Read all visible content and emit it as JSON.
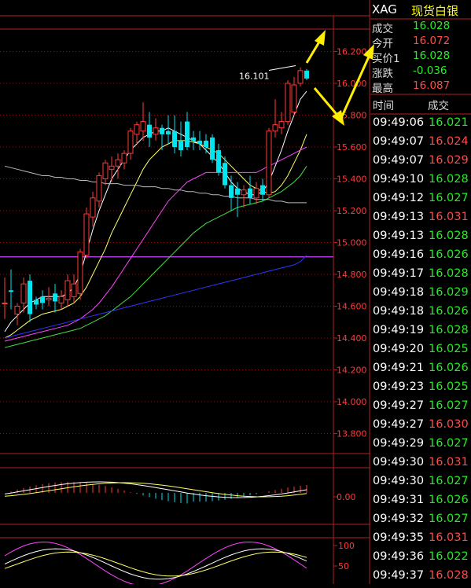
{
  "quote": {
    "symbol": "XAG",
    "name": "现货白银",
    "rows": [
      {
        "label": "成交",
        "value": "16.028",
        "color": "#22ee22"
      },
      {
        "label": "今开",
        "value": "16.072",
        "color": "#ff4a4a"
      },
      {
        "label": "买价1",
        "value": "16.028",
        "color": "#22ee22"
      },
      {
        "label": "涨跌",
        "value": "-0.036",
        "color": "#22ee22"
      },
      {
        "label": "最高",
        "value": "16.087",
        "color": "#ff4a4a"
      }
    ]
  },
  "ticks": {
    "col_time": "时间",
    "col_price": "成交",
    "rows": [
      {
        "time": "09:49:06",
        "price": "16.021"
      },
      {
        "time": "09:49:07",
        "price": "16.024"
      },
      {
        "time": "09:49:07",
        "price": "16.029"
      },
      {
        "time": "09:49:10",
        "price": "16.028"
      },
      {
        "time": "09:49:12",
        "price": "16.027"
      },
      {
        "time": "09:49:13",
        "price": "16.031"
      },
      {
        "time": "09:49:13",
        "price": "16.028"
      },
      {
        "time": "09:49:16",
        "price": "16.026"
      },
      {
        "time": "09:49:17",
        "price": "16.028"
      },
      {
        "time": "09:49:18",
        "price": "16.029"
      },
      {
        "time": "09:49:18",
        "price": "16.026"
      },
      {
        "time": "09:49:19",
        "price": "16.028"
      },
      {
        "time": "09:49:20",
        "price": "16.025"
      },
      {
        "time": "09:49:21",
        "price": "16.026"
      },
      {
        "time": "09:49:23",
        "price": "16.025"
      },
      {
        "time": "09:49:27",
        "price": "16.027"
      },
      {
        "time": "09:49:27",
        "price": "16.030"
      },
      {
        "time": "09:49:29",
        "price": "16.027"
      },
      {
        "time": "09:49:30",
        "price": "16.031"
      },
      {
        "time": "09:49:30",
        "price": "16.027"
      },
      {
        "time": "09:49:31",
        "price": "16.026"
      },
      {
        "time": "09:49:32",
        "price": "16.027"
      },
      {
        "time": "09:49:35",
        "price": "16.031"
      },
      {
        "time": "09:49:36",
        "price": "16.022"
      },
      {
        "time": "09:49:37",
        "price": "16.028"
      }
    ]
  },
  "chart_data": {
    "type": "candlestick",
    "high_label": "16.101",
    "price_axis": {
      "ticks": [
        "16.200",
        "16.000",
        "15.800",
        "15.600",
        "15.400",
        "15.200",
        "15.000",
        "14.800",
        "14.600",
        "14.400",
        "14.200",
        "14.000",
        "13.800"
      ],
      "range": [
        13.7,
        16.27
      ]
    },
    "candles": [
      {
        "o": 14.62,
        "h": 14.78,
        "l": 14.52,
        "c": 14.62
      },
      {
        "o": 14.7,
        "h": 14.83,
        "l": 14.58,
        "c": 14.69
      },
      {
        "o": 14.55,
        "h": 14.62,
        "l": 14.48,
        "c": 14.6
      },
      {
        "o": 14.62,
        "h": 14.78,
        "l": 14.56,
        "c": 14.74
      },
      {
        "o": 14.76,
        "h": 14.8,
        "l": 14.5,
        "c": 14.55
      },
      {
        "o": 14.64,
        "h": 14.66,
        "l": 14.58,
        "c": 14.61
      },
      {
        "o": 14.66,
        "h": 14.7,
        "l": 14.58,
        "c": 14.62
      },
      {
        "o": 14.64,
        "h": 14.72,
        "l": 14.6,
        "c": 14.65
      },
      {
        "o": 14.68,
        "h": 14.74,
        "l": 14.56,
        "c": 14.63
      },
      {
        "o": 14.62,
        "h": 14.7,
        "l": 14.58,
        "c": 14.66
      },
      {
        "o": 14.64,
        "h": 14.8,
        "l": 14.6,
        "c": 14.76
      },
      {
        "o": 14.66,
        "h": 14.8,
        "l": 14.62,
        "c": 14.74
      },
      {
        "o": 14.68,
        "h": 14.96,
        "l": 14.64,
        "c": 14.94
      },
      {
        "o": 14.92,
        "h": 15.22,
        "l": 14.9,
        "c": 15.18
      },
      {
        "o": 15.16,
        "h": 15.32,
        "l": 15.1,
        "c": 15.28
      },
      {
        "o": 15.26,
        "h": 15.44,
        "l": 15.22,
        "c": 15.42
      },
      {
        "o": 15.4,
        "h": 15.52,
        "l": 15.36,
        "c": 15.5
      },
      {
        "o": 15.46,
        "h": 15.54,
        "l": 15.38,
        "c": 15.48
      },
      {
        "o": 15.48,
        "h": 15.56,
        "l": 15.4,
        "c": 15.52
      },
      {
        "o": 15.5,
        "h": 15.58,
        "l": 15.46,
        "c": 15.56
      },
      {
        "o": 15.56,
        "h": 15.72,
        "l": 15.52,
        "c": 15.7
      },
      {
        "o": 15.68,
        "h": 15.76,
        "l": 15.62,
        "c": 15.74
      },
      {
        "o": 15.7,
        "h": 15.88,
        "l": 15.64,
        "c": 15.76
      },
      {
        "o": 15.74,
        "h": 15.82,
        "l": 15.6,
        "c": 15.66
      },
      {
        "o": 15.68,
        "h": 15.78,
        "l": 15.64,
        "c": 15.72
      },
      {
        "o": 15.72,
        "h": 15.74,
        "l": 15.58,
        "c": 15.68
      },
      {
        "o": 15.7,
        "h": 15.8,
        "l": 15.62,
        "c": 15.68
      },
      {
        "o": 15.7,
        "h": 15.8,
        "l": 15.56,
        "c": 15.6
      },
      {
        "o": 15.64,
        "h": 15.76,
        "l": 15.54,
        "c": 15.58
      },
      {
        "o": 15.76,
        "h": 15.82,
        "l": 15.58,
        "c": 15.6
      },
      {
        "o": 15.66,
        "h": 15.7,
        "l": 15.58,
        "c": 15.64
      },
      {
        "o": 15.64,
        "h": 15.7,
        "l": 15.58,
        "c": 15.62
      },
      {
        "o": 15.64,
        "h": 15.68,
        "l": 15.56,
        "c": 15.6
      },
      {
        "o": 15.66,
        "h": 15.68,
        "l": 15.5,
        "c": 15.52
      },
      {
        "o": 15.58,
        "h": 15.62,
        "l": 15.42,
        "c": 15.44
      },
      {
        "o": 15.5,
        "h": 15.54,
        "l": 15.34,
        "c": 15.36
      },
      {
        "o": 15.36,
        "h": 15.42,
        "l": 15.2,
        "c": 15.28
      },
      {
        "o": 15.34,
        "h": 15.38,
        "l": 15.16,
        "c": 15.3
      },
      {
        "o": 15.3,
        "h": 15.36,
        "l": 15.22,
        "c": 15.33
      },
      {
        "o": 15.34,
        "h": 15.42,
        "l": 15.24,
        "c": 15.28
      },
      {
        "o": 15.28,
        "h": 15.38,
        "l": 15.24,
        "c": 15.34
      },
      {
        "o": 15.36,
        "h": 15.4,
        "l": 15.26,
        "c": 15.3
      },
      {
        "o": 15.3,
        "h": 15.72,
        "l": 15.28,
        "c": 15.7
      },
      {
        "o": 15.7,
        "h": 15.9,
        "l": 15.66,
        "c": 15.74
      },
      {
        "o": 15.72,
        "h": 15.82,
        "l": 15.68,
        "c": 15.76
      },
      {
        "o": 15.76,
        "h": 16.02,
        "l": 15.74,
        "c": 16.0
      },
      {
        "o": 15.82,
        "h": 16.04,
        "l": 15.8,
        "c": 15.99
      },
      {
        "o": 16.0,
        "h": 16.1,
        "l": 15.98,
        "c": 16.08
      },
      {
        "o": 16.08,
        "h": 16.09,
        "l": 16.02,
        "c": 16.03
      }
    ],
    "ma_series": [
      {
        "color": "#ffffff",
        "values": [
          14.44,
          14.5,
          14.54,
          14.58,
          14.62,
          14.64,
          14.66,
          14.66,
          14.66,
          14.66,
          14.68,
          14.72,
          14.8,
          14.94,
          15.08,
          15.2,
          15.3,
          15.4,
          15.46,
          15.52,
          15.58,
          15.62,
          15.66,
          15.68,
          15.7,
          15.7,
          15.72,
          15.7,
          15.68,
          15.66,
          15.64,
          15.62,
          15.58,
          15.54,
          15.5,
          15.44,
          15.38,
          15.34,
          15.32,
          15.3,
          15.3,
          15.32,
          15.38,
          15.48,
          15.58,
          15.7,
          15.8,
          15.9,
          15.95
        ]
      },
      {
        "color": "#ffff66",
        "values": [
          14.4,
          14.42,
          14.45,
          14.48,
          14.51,
          14.53,
          14.55,
          14.56,
          14.57,
          14.58,
          14.6,
          14.62,
          14.66,
          14.72,
          14.8,
          14.88,
          14.96,
          15.06,
          15.14,
          15.22,
          15.3,
          15.38,
          15.46,
          15.52,
          15.56,
          15.6,
          15.62,
          15.64,
          15.64,
          15.64,
          15.63,
          15.62,
          15.6,
          15.58,
          15.56,
          15.52,
          15.48,
          15.44,
          15.4,
          15.36,
          15.34,
          15.32,
          15.31,
          15.32,
          15.36,
          15.42,
          15.5,
          15.58,
          15.68
        ]
      },
      {
        "color": "#ff44ff",
        "values": [
          14.38,
          14.39,
          14.4,
          14.41,
          14.42,
          14.43,
          14.44,
          14.45,
          14.46,
          14.47,
          14.48,
          14.5,
          14.52,
          14.55,
          14.58,
          14.62,
          14.67,
          14.72,
          14.78,
          14.84,
          14.9,
          14.96,
          15.02,
          15.08,
          15.14,
          15.2,
          15.26,
          15.3,
          15.34,
          15.38,
          15.4,
          15.42,
          15.44,
          15.44,
          15.44,
          15.44,
          15.44,
          15.44,
          15.44,
          15.44,
          15.44,
          15.46,
          15.48,
          15.5,
          15.52,
          15.54,
          15.56,
          15.58,
          15.6
        ]
      },
      {
        "color": "#44dd44",
        "values": [
          14.34,
          14.35,
          14.36,
          14.37,
          14.38,
          14.39,
          14.4,
          14.41,
          14.42,
          14.43,
          14.44,
          14.45,
          14.46,
          14.48,
          14.5,
          14.52,
          14.54,
          14.57,
          14.6,
          14.63,
          14.66,
          14.7,
          14.74,
          14.78,
          14.82,
          14.86,
          14.9,
          14.94,
          14.98,
          15.02,
          15.06,
          15.09,
          15.12,
          15.14,
          15.16,
          15.18,
          15.2,
          15.22,
          15.23,
          15.24,
          15.25,
          15.26,
          15.28,
          15.3,
          15.32,
          15.35,
          15.38,
          15.42,
          15.48
        ]
      },
      {
        "color": "#3333ff",
        "values": [
          14.4,
          14.41,
          14.42,
          14.43,
          14.44,
          14.45,
          14.46,
          14.47,
          14.48,
          14.49,
          14.5,
          14.51,
          14.52,
          14.53,
          14.54,
          14.55,
          14.56,
          14.57,
          14.58,
          14.59,
          14.6,
          14.61,
          14.62,
          14.63,
          14.64,
          14.65,
          14.66,
          14.67,
          14.68,
          14.69,
          14.7,
          14.71,
          14.72,
          14.73,
          14.74,
          14.75,
          14.76,
          14.77,
          14.78,
          14.79,
          14.8,
          14.81,
          14.82,
          14.83,
          14.84,
          14.85,
          14.86,
          14.88,
          14.92
        ]
      },
      {
        "color": "#bbbbbb",
        "values": [
          15.48,
          15.47,
          15.46,
          15.45,
          15.44,
          15.43,
          15.42,
          15.42,
          15.41,
          15.41,
          15.4,
          15.4,
          15.39,
          15.39,
          15.38,
          15.38,
          15.37,
          15.37,
          15.37,
          15.36,
          15.36,
          15.36,
          15.35,
          15.35,
          15.35,
          15.34,
          15.34,
          15.33,
          15.33,
          15.32,
          15.32,
          15.31,
          15.31,
          15.3,
          15.3,
          15.29,
          15.29,
          15.28,
          15.28,
          15.28,
          15.27,
          15.27,
          15.27,
          15.26,
          15.26,
          15.25,
          15.25,
          15.25,
          15.25
        ]
      }
    ],
    "hline_purple": 14.91,
    "macd_axis_label": "0.00",
    "kdj_axis_labels": [
      "100",
      "50"
    ]
  }
}
